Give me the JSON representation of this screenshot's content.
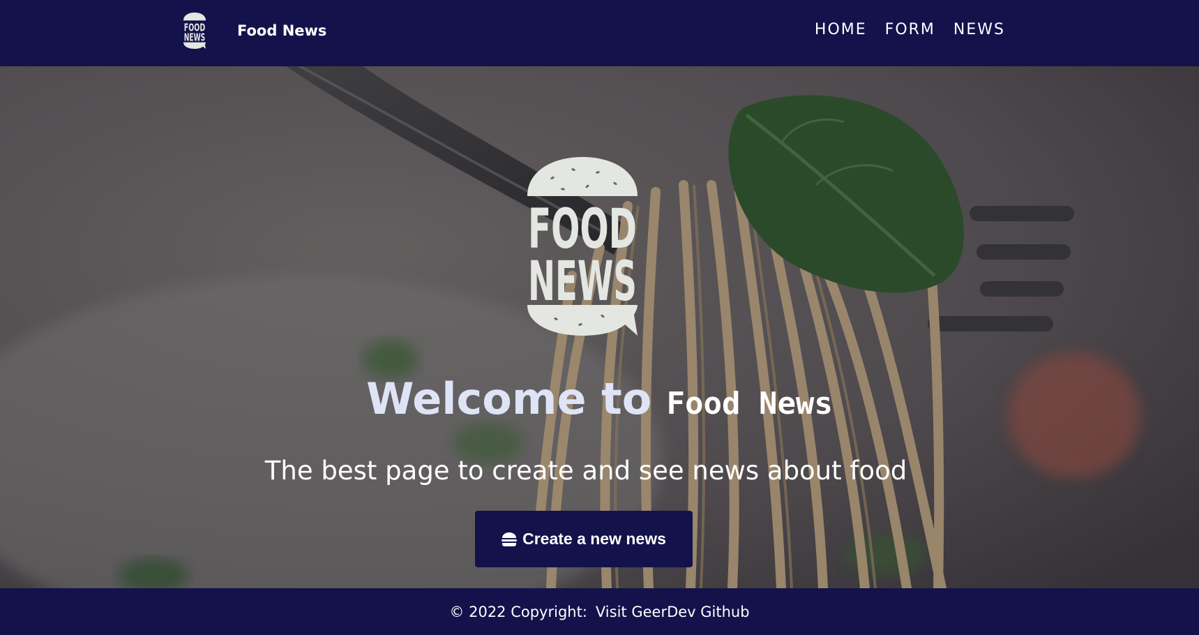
{
  "colors": {
    "navy": "#13124b",
    "title_accent": "#dfe3f6",
    "logo_fill": "#e4e6e2"
  },
  "navbar": {
    "logo_icon": "food-news-burger-logo",
    "logo_text_line1": "FOOD",
    "logo_text_line2": "NEWS",
    "brand": "Food News",
    "links": [
      {
        "label": "HOME"
      },
      {
        "label": "FORM"
      },
      {
        "label": "NEWS"
      }
    ]
  },
  "hero": {
    "background": "spaghetti-on-fork-photo",
    "logo_icon": "food-news-burger-logo",
    "logo_text_line1": "FOOD",
    "logo_text_line2": "NEWS",
    "title_welcome": "Welcome to",
    "title_brand": "Food News",
    "subtitle": "The best page to create and see news about food",
    "cta": {
      "icon": "burger-icon",
      "label": "Create a new news"
    }
  },
  "footer": {
    "copyright": "© 2022 Copyright:",
    "link": "Visit GeerDev Github"
  }
}
